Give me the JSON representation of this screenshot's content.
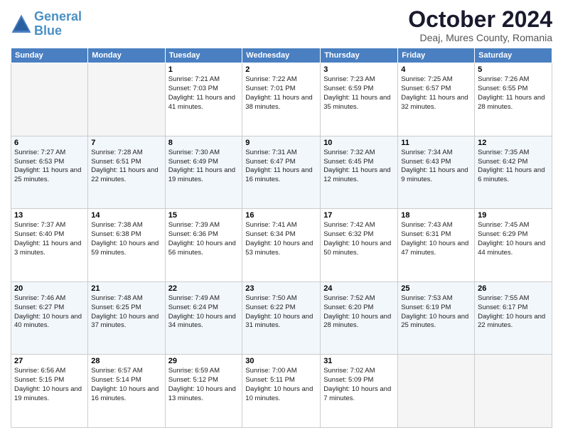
{
  "header": {
    "logo_line1": "General",
    "logo_line2": "Blue",
    "month": "October 2024",
    "location": "Deaj, Mures County, Romania"
  },
  "weekdays": [
    "Sunday",
    "Monday",
    "Tuesday",
    "Wednesday",
    "Thursday",
    "Friday",
    "Saturday"
  ],
  "weeks": [
    [
      {
        "day": "",
        "info": ""
      },
      {
        "day": "",
        "info": ""
      },
      {
        "day": "1",
        "info": "Sunrise: 7:21 AM\nSunset: 7:03 PM\nDaylight: 11 hours and 41 minutes."
      },
      {
        "day": "2",
        "info": "Sunrise: 7:22 AM\nSunset: 7:01 PM\nDaylight: 11 hours and 38 minutes."
      },
      {
        "day": "3",
        "info": "Sunrise: 7:23 AM\nSunset: 6:59 PM\nDaylight: 11 hours and 35 minutes."
      },
      {
        "day": "4",
        "info": "Sunrise: 7:25 AM\nSunset: 6:57 PM\nDaylight: 11 hours and 32 minutes."
      },
      {
        "day": "5",
        "info": "Sunrise: 7:26 AM\nSunset: 6:55 PM\nDaylight: 11 hours and 28 minutes."
      }
    ],
    [
      {
        "day": "6",
        "info": "Sunrise: 7:27 AM\nSunset: 6:53 PM\nDaylight: 11 hours and 25 minutes."
      },
      {
        "day": "7",
        "info": "Sunrise: 7:28 AM\nSunset: 6:51 PM\nDaylight: 11 hours and 22 minutes."
      },
      {
        "day": "8",
        "info": "Sunrise: 7:30 AM\nSunset: 6:49 PM\nDaylight: 11 hours and 19 minutes."
      },
      {
        "day": "9",
        "info": "Sunrise: 7:31 AM\nSunset: 6:47 PM\nDaylight: 11 hours and 16 minutes."
      },
      {
        "day": "10",
        "info": "Sunrise: 7:32 AM\nSunset: 6:45 PM\nDaylight: 11 hours and 12 minutes."
      },
      {
        "day": "11",
        "info": "Sunrise: 7:34 AM\nSunset: 6:43 PM\nDaylight: 11 hours and 9 minutes."
      },
      {
        "day": "12",
        "info": "Sunrise: 7:35 AM\nSunset: 6:42 PM\nDaylight: 11 hours and 6 minutes."
      }
    ],
    [
      {
        "day": "13",
        "info": "Sunrise: 7:37 AM\nSunset: 6:40 PM\nDaylight: 11 hours and 3 minutes."
      },
      {
        "day": "14",
        "info": "Sunrise: 7:38 AM\nSunset: 6:38 PM\nDaylight: 10 hours and 59 minutes."
      },
      {
        "day": "15",
        "info": "Sunrise: 7:39 AM\nSunset: 6:36 PM\nDaylight: 10 hours and 56 minutes."
      },
      {
        "day": "16",
        "info": "Sunrise: 7:41 AM\nSunset: 6:34 PM\nDaylight: 10 hours and 53 minutes."
      },
      {
        "day": "17",
        "info": "Sunrise: 7:42 AM\nSunset: 6:32 PM\nDaylight: 10 hours and 50 minutes."
      },
      {
        "day": "18",
        "info": "Sunrise: 7:43 AM\nSunset: 6:31 PM\nDaylight: 10 hours and 47 minutes."
      },
      {
        "day": "19",
        "info": "Sunrise: 7:45 AM\nSunset: 6:29 PM\nDaylight: 10 hours and 44 minutes."
      }
    ],
    [
      {
        "day": "20",
        "info": "Sunrise: 7:46 AM\nSunset: 6:27 PM\nDaylight: 10 hours and 40 minutes."
      },
      {
        "day": "21",
        "info": "Sunrise: 7:48 AM\nSunset: 6:25 PM\nDaylight: 10 hours and 37 minutes."
      },
      {
        "day": "22",
        "info": "Sunrise: 7:49 AM\nSunset: 6:24 PM\nDaylight: 10 hours and 34 minutes."
      },
      {
        "day": "23",
        "info": "Sunrise: 7:50 AM\nSunset: 6:22 PM\nDaylight: 10 hours and 31 minutes."
      },
      {
        "day": "24",
        "info": "Sunrise: 7:52 AM\nSunset: 6:20 PM\nDaylight: 10 hours and 28 minutes."
      },
      {
        "day": "25",
        "info": "Sunrise: 7:53 AM\nSunset: 6:19 PM\nDaylight: 10 hours and 25 minutes."
      },
      {
        "day": "26",
        "info": "Sunrise: 7:55 AM\nSunset: 6:17 PM\nDaylight: 10 hours and 22 minutes."
      }
    ],
    [
      {
        "day": "27",
        "info": "Sunrise: 6:56 AM\nSunset: 5:15 PM\nDaylight: 10 hours and 19 minutes."
      },
      {
        "day": "28",
        "info": "Sunrise: 6:57 AM\nSunset: 5:14 PM\nDaylight: 10 hours and 16 minutes."
      },
      {
        "day": "29",
        "info": "Sunrise: 6:59 AM\nSunset: 5:12 PM\nDaylight: 10 hours and 13 minutes."
      },
      {
        "day": "30",
        "info": "Sunrise: 7:00 AM\nSunset: 5:11 PM\nDaylight: 10 hours and 10 minutes."
      },
      {
        "day": "31",
        "info": "Sunrise: 7:02 AM\nSunset: 5:09 PM\nDaylight: 10 hours and 7 minutes."
      },
      {
        "day": "",
        "info": ""
      },
      {
        "day": "",
        "info": ""
      }
    ]
  ]
}
